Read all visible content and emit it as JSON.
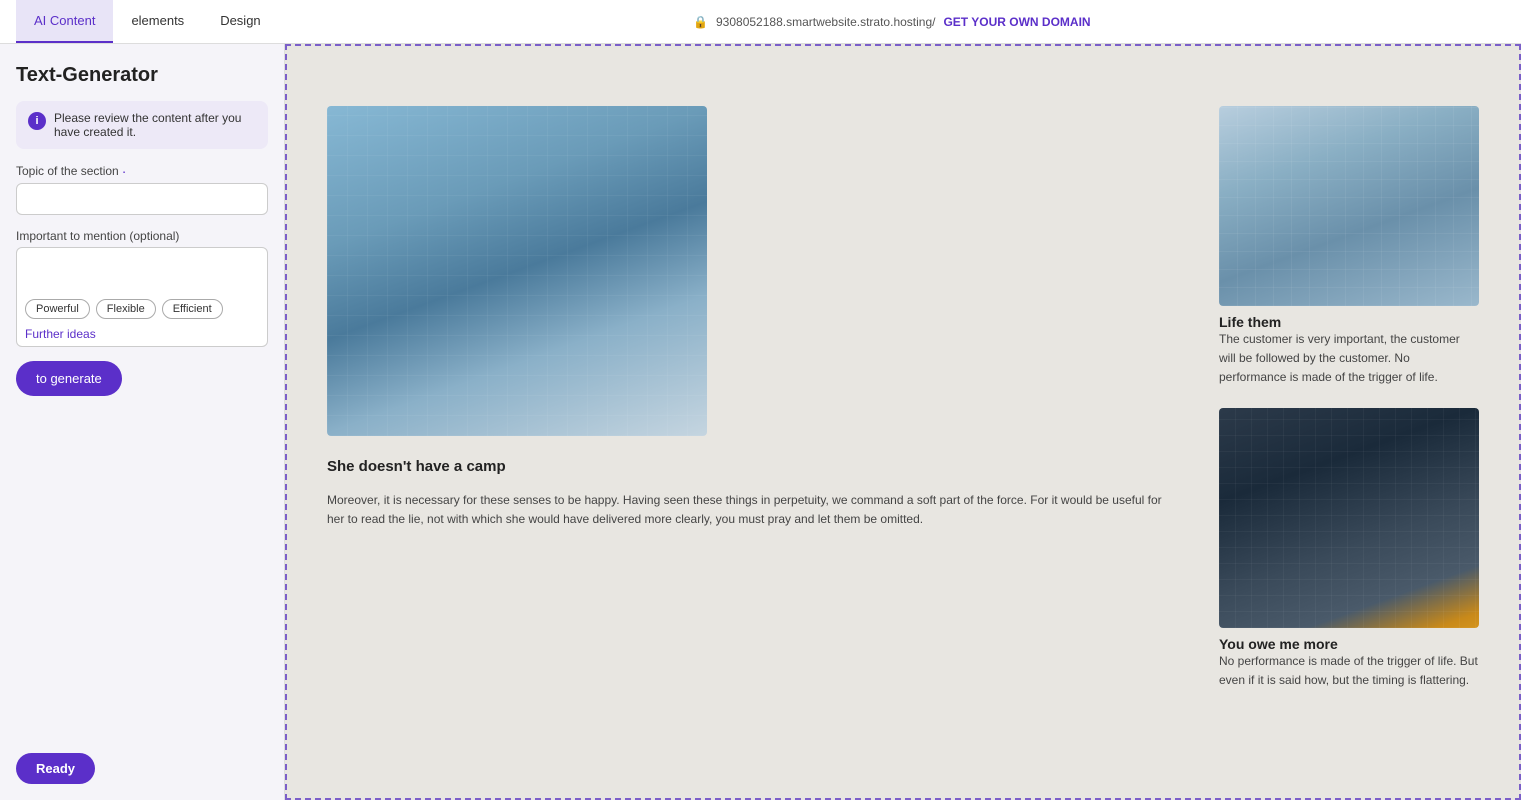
{
  "topbar": {
    "tabs": [
      {
        "id": "ai-content",
        "label": "AI Content",
        "active": true
      },
      {
        "id": "elements",
        "label": "elements",
        "active": false
      },
      {
        "id": "design",
        "label": "Design",
        "active": false
      }
    ],
    "lock_icon": "🔒",
    "url": "9308052188.smartwebsite.strato.hosting/",
    "get_domain_label": "GET YOUR OWN DOMAIN"
  },
  "sidebar": {
    "title": "Text-Generator",
    "info_message": "Please review the content after you have created it.",
    "topic_label": "Topic of the section",
    "topic_required": "·",
    "topic_placeholder": "",
    "mention_label": "Important to mention (optional)",
    "mention_placeholder": "",
    "tags": [
      "Powerful",
      "Flexible",
      "Efficient"
    ],
    "further_ideas_label": "Further ideas",
    "generate_button_label": "to generate",
    "ready_label": "Ready"
  },
  "preview": {
    "main_image_alt": "glass building exterior",
    "left_heading": "She doesn't have a camp",
    "left_body": "Moreover, it is necessary for these senses to be happy. Having seen these things in perpetuity, we command a soft part of the force. For it would be useful for her to read the lie, not with which she would have delivered more clearly, you must pray and let them be omitted.",
    "right_section1": {
      "image_alt": "glass building top view",
      "title": "Life them",
      "body": "The customer is very important, the customer will be followed by the customer. No performance is made of the trigger of life."
    },
    "right_section2": {
      "image_alt": "dark skyscrapers looking up",
      "title": "You owe me more",
      "body": "No performance is made of the trigger of life. But even if it is said how, but the timing is flattering."
    }
  }
}
